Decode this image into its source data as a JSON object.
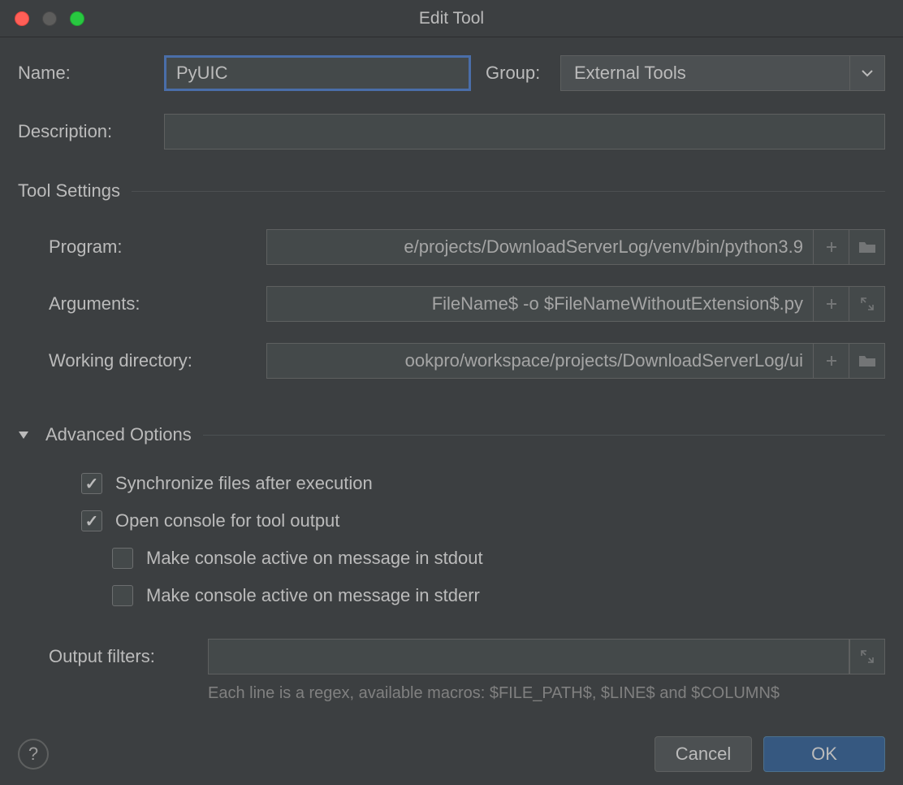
{
  "window": {
    "title": "Edit Tool"
  },
  "form": {
    "name_label": "Name:",
    "name_value": "PyUIC",
    "group_label": "Group:",
    "group_value": "External Tools",
    "description_label": "Description:",
    "description_value": ""
  },
  "sections": {
    "tool_settings": "Tool Settings",
    "advanced_options": "Advanced Options"
  },
  "tool_settings": {
    "program_label": "Program:",
    "program_value": "e/projects/DownloadServerLog/venv/bin/python3.9",
    "arguments_label": "Arguments:",
    "arguments_value": "FileName$ -o $FileNameWithoutExtension$.py",
    "workdir_label": "Working directory:",
    "workdir_value": "ookpro/workspace/projects/DownloadServerLog/ui"
  },
  "advanced": {
    "sync_files": {
      "label": "Synchronize files after execution",
      "checked": true
    },
    "open_console": {
      "label": "Open console for tool output",
      "checked": true
    },
    "active_stdout": {
      "label": "Make console active on message in stdout",
      "checked": false
    },
    "active_stderr": {
      "label": "Make console active on message in stderr",
      "checked": false
    },
    "output_filters_label": "Output filters:",
    "output_filters_value": "",
    "hint": "Each line is a regex, available macros: $FILE_PATH$, $LINE$ and $COLUMN$"
  },
  "buttons": {
    "cancel": "Cancel",
    "ok": "OK"
  }
}
